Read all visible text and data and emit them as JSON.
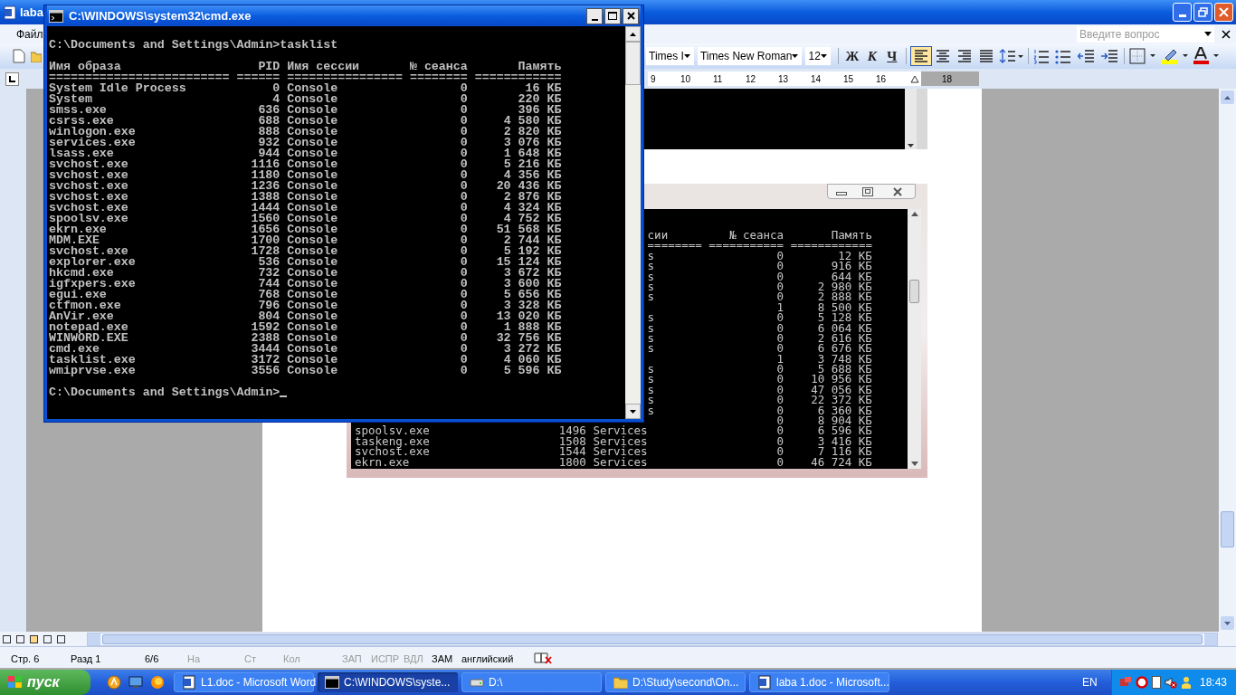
{
  "word_window": {
    "title": "laba",
    "menu": [
      "Файл"
    ],
    "help_box": {
      "placeholder": "Введите вопрос"
    },
    "formatting": {
      "style": "Times I",
      "font": "Times New Roman",
      "size": "12"
    },
    "format_buttons": [
      {
        "label": "Ж",
        "kind": "bold"
      },
      {
        "label": "К",
        "kind": "italic"
      },
      {
        "label": "Ч",
        "kind": "underline"
      }
    ],
    "align_buttons": [
      {
        "kind": "left",
        "selected": true
      },
      {
        "kind": "center",
        "selected": false
      },
      {
        "kind": "right",
        "selected": false
      },
      {
        "kind": "justify",
        "selected": false
      }
    ],
    "ruler": [
      "9",
      "10",
      "11",
      "12",
      "13",
      "14",
      "15",
      "16",
      "18"
    ],
    "screenshot": {
      "header": {
        "session_tail": "сии",
        "session_no": "№ сеанса",
        "memory": "Память"
      },
      "separator": [
        "========",
        "===========",
        "============"
      ],
      "rows": [
        {
          "tail": "s",
          "session_no": "0",
          "memory": "12 КБ"
        },
        {
          "tail": "s",
          "session_no": "0",
          "memory": "916 КБ"
        },
        {
          "tail": "s",
          "session_no": "0",
          "memory": "644 КБ"
        },
        {
          "tail": "s",
          "session_no": "0",
          "memory": "2 980 КБ"
        },
        {
          "tail": "s",
          "session_no": "0",
          "memory": "2 888 КБ"
        },
        {
          "session_no": "1",
          "memory": "8 500 КБ"
        },
        {
          "tail": "s",
          "session_no": "0",
          "memory": "5 128 КБ"
        },
        {
          "tail": "s",
          "session_no": "0",
          "memory": "6 064 КБ"
        },
        {
          "tail": "s",
          "session_no": "0",
          "memory": "2 616 КБ"
        },
        {
          "tail": "s",
          "session_no": "0",
          "memory": "6 676 КБ"
        },
        {
          "session_no": "1",
          "memory": "3 748 КБ"
        },
        {
          "tail": "s",
          "session_no": "0",
          "memory": "5 688 КБ"
        },
        {
          "tail": "s",
          "session_no": "0",
          "memory": "10 956 КБ"
        },
        {
          "tail": "s",
          "session_no": "0",
          "memory": "47 056 КБ"
        },
        {
          "tail": "s",
          "session_no": "0",
          "memory": "22 372 КБ"
        },
        {
          "tail": "s",
          "session_no": "0",
          "memory": "6 360 КБ"
        },
        {
          "session_no": "0",
          "memory": "8 904 КБ"
        },
        {
          "name": "spoolsv.exe",
          "pid": "1496",
          "session": "Services",
          "session_no": "0",
          "memory": "6 596 КБ"
        },
        {
          "name": "taskeng.exe",
          "pid": "1508",
          "session": "Services",
          "session_no": "0",
          "memory": "3 416 КБ"
        },
        {
          "name": "svchost.exe",
          "pid": "1544",
          "session": "Services",
          "session_no": "0",
          "memory": "7 116 КБ"
        },
        {
          "name": "ekrn.exe",
          "pid": "1800",
          "session": "Services",
          "session_no": "0",
          "memory": "46 724 КБ"
        }
      ]
    },
    "status_bar": [
      {
        "text": "Стр. 6",
        "on": true
      },
      {
        "text": "Разд 1",
        "on": true
      },
      {
        "text": "6/6",
        "on": true
      },
      {
        "text": "На",
        "on": false
      },
      {
        "text": "Ст",
        "on": false
      },
      {
        "text": "Кол",
        "on": false
      },
      {
        "text": "ЗАП",
        "on": false
      },
      {
        "text": "ИСПР",
        "on": false
      },
      {
        "text": "ВДЛ",
        "on": false
      },
      {
        "text": "ЗАМ",
        "on": true
      },
      {
        "text": "английский",
        "on": true
      }
    ]
  },
  "cmd_window": {
    "title": "C:\\WINDOWS\\system32\\cmd.exe",
    "command": "C:\\Documents and Settings\\Admin>tasklist",
    "columns": [
      "Имя образа",
      "PID",
      "Имя сессии",
      "№ сеанса",
      "Память"
    ],
    "separator": [
      "=========================",
      "======",
      "================",
      "========",
      "============"
    ],
    "rows": [
      {
        "name": "System Idle Process",
        "pid": "0",
        "session": "Console",
        "session_no": "0",
        "memory": "16 КБ"
      },
      {
        "name": "System",
        "pid": "4",
        "session": "Console",
        "session_no": "0",
        "memory": "220 КБ"
      },
      {
        "name": "smss.exe",
        "pid": "636",
        "session": "Console",
        "session_no": "0",
        "memory": "396 КБ"
      },
      {
        "name": "csrss.exe",
        "pid": "688",
        "session": "Console",
        "session_no": "0",
        "memory": "4 580 КБ"
      },
      {
        "name": "winlogon.exe",
        "pid": "888",
        "session": "Console",
        "session_no": "0",
        "memory": "2 820 КБ"
      },
      {
        "name": "services.exe",
        "pid": "932",
        "session": "Console",
        "session_no": "0",
        "memory": "3 076 КБ"
      },
      {
        "name": "lsass.exe",
        "pid": "944",
        "session": "Console",
        "session_no": "0",
        "memory": "1 648 КБ"
      },
      {
        "name": "svchost.exe",
        "pid": "1116",
        "session": "Console",
        "session_no": "0",
        "memory": "5 216 КБ"
      },
      {
        "name": "svchost.exe",
        "pid": "1180",
        "session": "Console",
        "session_no": "0",
        "memory": "4 356 КБ"
      },
      {
        "name": "svchost.exe",
        "pid": "1236",
        "session": "Console",
        "session_no": "0",
        "memory": "20 436 КБ"
      },
      {
        "name": "svchost.exe",
        "pid": "1388",
        "session": "Console",
        "session_no": "0",
        "memory": "2 876 КБ"
      },
      {
        "name": "svchost.exe",
        "pid": "1444",
        "session": "Console",
        "session_no": "0",
        "memory": "4 324 КБ"
      },
      {
        "name": "spoolsv.exe",
        "pid": "1560",
        "session": "Console",
        "session_no": "0",
        "memory": "4 752 КБ"
      },
      {
        "name": "ekrn.exe",
        "pid": "1656",
        "session": "Console",
        "session_no": "0",
        "memory": "51 568 КБ"
      },
      {
        "name": "MDM.EXE",
        "pid": "1700",
        "session": "Console",
        "session_no": "0",
        "memory": "2 744 КБ"
      },
      {
        "name": "svchost.exe",
        "pid": "1728",
        "session": "Console",
        "session_no": "0",
        "memory": "5 192 КБ"
      },
      {
        "name": "explorer.exe",
        "pid": "536",
        "session": "Console",
        "session_no": "0",
        "memory": "15 124 КБ"
      },
      {
        "name": "hkcmd.exe",
        "pid": "732",
        "session": "Console",
        "session_no": "0",
        "memory": "3 672 КБ"
      },
      {
        "name": "igfxpers.exe",
        "pid": "744",
        "session": "Console",
        "session_no": "0",
        "memory": "3 600 КБ"
      },
      {
        "name": "egui.exe",
        "pid": "768",
        "session": "Console",
        "session_no": "0",
        "memory": "5 656 КБ"
      },
      {
        "name": "ctfmon.exe",
        "pid": "796",
        "session": "Console",
        "session_no": "0",
        "memory": "3 328 КБ"
      },
      {
        "name": "AnVir.exe",
        "pid": "804",
        "session": "Console",
        "session_no": "0",
        "memory": "13 020 КБ"
      },
      {
        "name": "notepad.exe",
        "pid": "1592",
        "session": "Console",
        "session_no": "0",
        "memory": "1 888 КБ"
      },
      {
        "name": "WINWORD.EXE",
        "pid": "2388",
        "session": "Console",
        "session_no": "0",
        "memory": "32 756 КБ"
      },
      {
        "name": "cmd.exe",
        "pid": "3444",
        "session": "Console",
        "session_no": "0",
        "memory": "3 272 КБ"
      },
      {
        "name": "tasklist.exe",
        "pid": "3172",
        "session": "Console",
        "session_no": "0",
        "memory": "4 060 КБ"
      },
      {
        "name": "wmiprvse.exe",
        "pid": "3556",
        "session": "Console",
        "session_no": "0",
        "memory": "5 596 КБ"
      }
    ],
    "prompt": "C:\\Documents and Settings\\Admin>"
  },
  "taskbar": {
    "start": "пуск",
    "tasks": [
      {
        "label": "L1.doc - Microsoft Word",
        "kind": "word",
        "selected": false
      },
      {
        "label": "C:\\WINDOWS\\syste...",
        "kind": "cmd",
        "selected": true
      },
      {
        "label": "D:\\",
        "kind": "drive",
        "selected": false
      },
      {
        "label": "D:\\Study\\second\\On...",
        "kind": "folder",
        "selected": false
      },
      {
        "label": "laba 1.doc - Microsoft...",
        "kind": "word",
        "selected": false
      }
    ],
    "language": "EN",
    "clock": "18:43"
  }
}
